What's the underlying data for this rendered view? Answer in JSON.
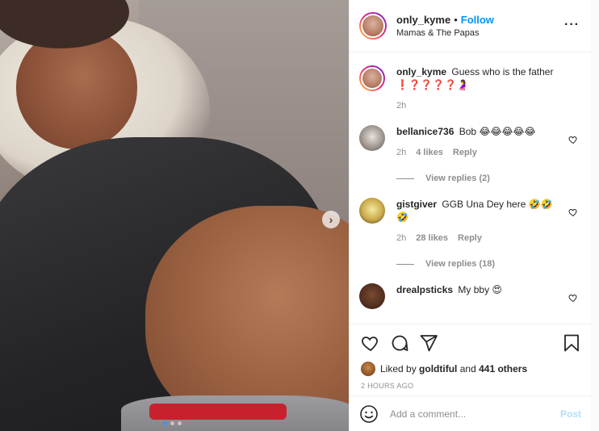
{
  "post": {
    "username": "only_kyme",
    "bullet": "•",
    "follow_label": "Follow",
    "location": "Mamas & The Papas",
    "more_glyph": "···",
    "carousel": {
      "slide_count": 3,
      "active_slide": 1,
      "next_glyph": "›"
    }
  },
  "caption": {
    "username": "only_kyme",
    "text": "Guess who is the father",
    "emojis": "❗❓❓❓❓🤰",
    "time": "2h"
  },
  "comments": [
    {
      "username": "bellanice736",
      "text": "Bob",
      "emojis": "😂😂😂😂😂",
      "time": "2h",
      "likes": "4 likes",
      "reply_label": "Reply",
      "view_replies": "View replies (2)"
    },
    {
      "username": "gistgiver",
      "text": "GGB Una Dey here",
      "emojis": "🤣🤣🤣",
      "time": "2h",
      "likes": "28 likes",
      "reply_label": "Reply",
      "view_replies": "View replies (18)"
    },
    {
      "username": "drealpsticks",
      "text": "My bby",
      "emojis": "😍",
      "time": "",
      "likes": "",
      "reply_label": ""
    }
  ],
  "likes": {
    "prefix": "Liked by",
    "user": "goldtiful",
    "joiner": "and",
    "others": "441 others"
  },
  "timestamp": "2 HOURS AGO",
  "composer": {
    "placeholder": "Add a comment...",
    "post_label": "Post"
  },
  "colors": {
    "accent": "#0095f6",
    "post_disabled": "#b2dffc",
    "carousel_dot_active": "#3897f0",
    "meta_gray": "#8e8e8e"
  },
  "icons": [
    "heart-icon",
    "comment-icon",
    "share-icon",
    "bookmark-icon",
    "smile-icon",
    "more-icon",
    "chevron-right-icon"
  ]
}
